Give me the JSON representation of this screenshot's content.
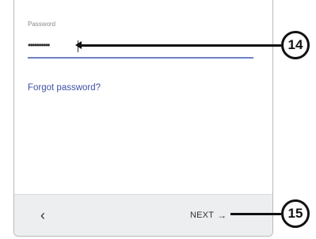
{
  "password_field": {
    "label": "Password",
    "value": "••••••••••"
  },
  "forgot_link": "Forgot password?",
  "bottom_bar": {
    "back_label": "‹",
    "next_label": "NEXT",
    "next_arrow": "→"
  },
  "callouts": {
    "c14": "14",
    "c15": "15"
  },
  "colors": {
    "accent": "#6f7fc7",
    "link": "#3f51a5",
    "bar": "#eceeef"
  }
}
